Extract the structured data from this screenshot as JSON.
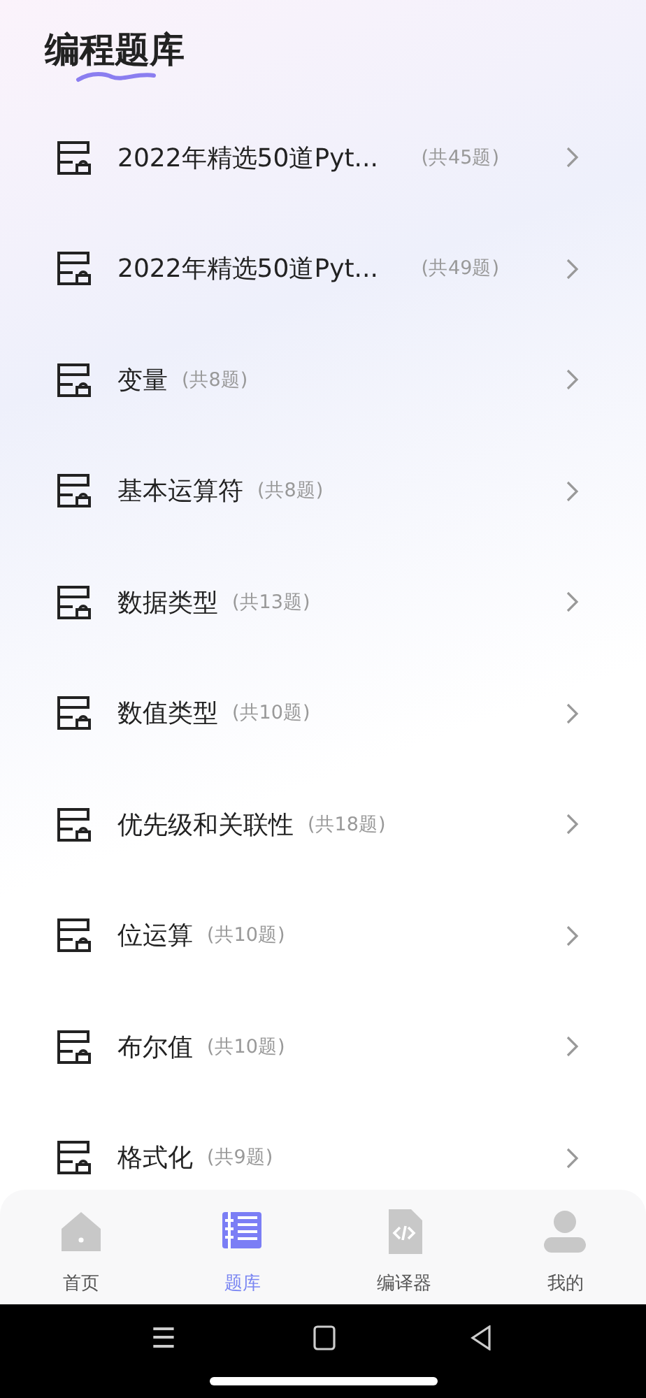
{
  "header": {
    "title": "编程题库"
  },
  "items": [
    {
      "name": "2022年精选50道Pyt...",
      "count": "(共45题)"
    },
    {
      "name": "2022年精选50道Pyt...",
      "count": "(共49题)"
    },
    {
      "name": "变量",
      "count": "(共8题)"
    },
    {
      "name": "基本运算符",
      "count": "(共8题)"
    },
    {
      "name": "数据类型",
      "count": "(共13题)"
    },
    {
      "name": "数值类型",
      "count": "(共10题)"
    },
    {
      "name": "优先级和关联性",
      "count": "(共18题)"
    },
    {
      "name": "位运算",
      "count": "(共10题)"
    },
    {
      "name": "布尔值",
      "count": "(共10题)"
    },
    {
      "name": "格式化",
      "count": "(共9题)"
    }
  ],
  "tab_bar": [
    {
      "kind": "home",
      "label": "首页",
      "selected": false
    },
    {
      "kind": "bank",
      "label": "题库",
      "selected": true
    },
    {
      "kind": "code",
      "label": "编译器",
      "selected": false
    },
    {
      "kind": "user",
      "label": "我的",
      "selected": false
    }
  ],
  "system_nav": [
    "☰"
  ]
}
